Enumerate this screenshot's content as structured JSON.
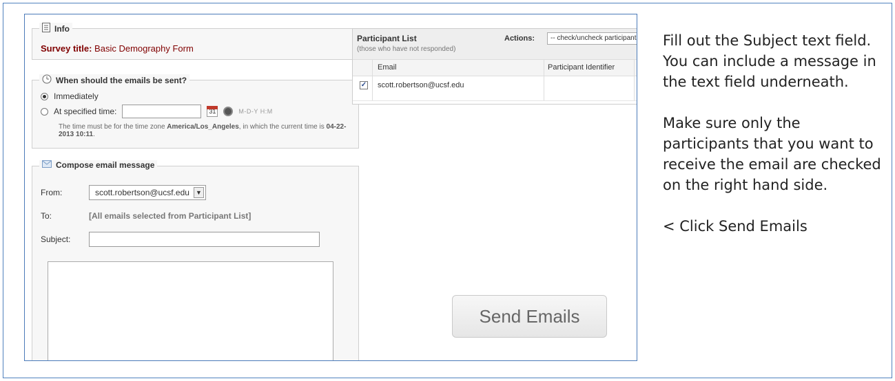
{
  "info": {
    "legend": "Info",
    "survey_label": "Survey title:",
    "survey_title": "Basic Demography Form"
  },
  "schedule": {
    "legend": "When should the emails be sent?",
    "option_immediately": "Immediately",
    "option_specified": "At specified time:",
    "time_value": "",
    "time_format": "M-D-Y H:M",
    "calendar_day": "31",
    "note_prefix": "The time must be for the time zone ",
    "timezone": "America/Los_Angeles",
    "note_mid": ", in which the current time is ",
    "current_time": "04-22-2013 10:11",
    "note_suffix": "."
  },
  "compose": {
    "legend": "Compose email message",
    "from_label": "From:",
    "from_value": "scott.robertson@ucsf.edu",
    "to_label": "To:",
    "to_value": "[All emails selected from Participant List]",
    "subject_label": "Subject:",
    "subject_value": "",
    "message_value": ""
  },
  "participants": {
    "title": "Participant List",
    "subtitle": "(those who have not responded)",
    "actions_label": "Actions:",
    "actions_value": "-- check/uncheck participants --",
    "columns": [
      "Email",
      "Participant Identifier"
    ],
    "rows": [
      {
        "checked": true,
        "email": "scott.robertson@ucsf.edu",
        "identifier": ""
      }
    ]
  },
  "send_button": "Send Emails",
  "instructions": {
    "p1": "Fill out the Subject text field. You can include a message in the text field underneath.",
    "p2": "Make sure only the participants that you want to receive the email are checked on the right hand side.",
    "p3": "< Click Send Emails"
  }
}
